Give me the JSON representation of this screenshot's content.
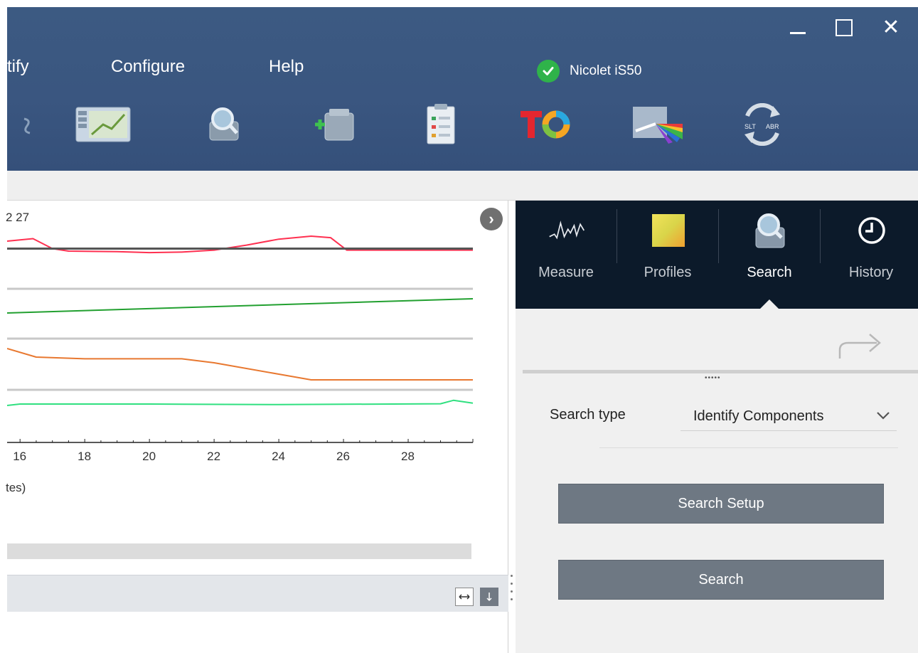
{
  "window": {
    "minimize_icon": "minimize-icon",
    "maximize_icon": "maximize-icon",
    "close_icon": "close-icon",
    "close_glyph": "✕"
  },
  "menu": {
    "items": [
      {
        "label": "tify"
      },
      {
        "label": "Configure"
      },
      {
        "label": "Help"
      }
    ]
  },
  "device": {
    "name": "Nicolet iS50",
    "status": "connected",
    "status_color": "#2fb34a"
  },
  "toolbar": {
    "icons": [
      "workflow-icon",
      "search-library-icon",
      "add-library-icon",
      "report-icon",
      "to-logo-icon",
      "spectrum-prism-icon",
      "convert-icon"
    ]
  },
  "chart_data": {
    "type": "line",
    "title": "2 27",
    "xlabel": "tes)",
    "x_ticks": [
      "16",
      "18",
      "20",
      "22",
      "24",
      "26",
      "28"
    ],
    "x_range": [
      15.6,
      30
    ],
    "series": [
      {
        "color": "#ff3050",
        "x": [
          15.6,
          16.4,
          17,
          17.5,
          19,
          20,
          21,
          22,
          23,
          24,
          25,
          25.6,
          26.1,
          27,
          30
        ],
        "y": [
          0.9,
          0.95,
          0.75,
          0.7,
          0.69,
          0.67,
          0.68,
          0.72,
          0.82,
          0.94,
          1.0,
          0.97,
          0.72,
          0.72,
          0.72
        ]
      },
      {
        "color": "#555555",
        "x": [
          15.6,
          30
        ],
        "y": [
          0.75,
          0.75
        ]
      },
      {
        "color": "#22a030",
        "x": [
          15.6,
          30
        ],
        "y": [
          0.4,
          0.65
        ]
      },
      {
        "color": "#e87830",
        "x": [
          15.6,
          16.5,
          18,
          21,
          22,
          24,
          25,
          30
        ],
        "y": [
          0.9,
          0.75,
          0.72,
          0.72,
          0.65,
          0.45,
          0.35,
          0.35
        ]
      },
      {
        "color": "#30e080",
        "x": [
          15.6,
          16,
          20,
          24,
          29,
          29.4,
          30
        ],
        "y": [
          0.3,
          0.35,
          0.35,
          0.33,
          0.36,
          0.48,
          0.38
        ]
      }
    ]
  },
  "right_panel": {
    "tabs": [
      {
        "label": "Measure",
        "icon": "measure-icon"
      },
      {
        "label": "Profiles",
        "icon": "profiles-icon"
      },
      {
        "label": "Search",
        "icon": "search-icon",
        "active": true
      },
      {
        "label": "History",
        "icon": "clock-icon"
      }
    ],
    "search_type_label": "Search type",
    "search_type_value": "Identify Components",
    "buttons": {
      "setup": "Search Setup",
      "search": "Search"
    }
  }
}
